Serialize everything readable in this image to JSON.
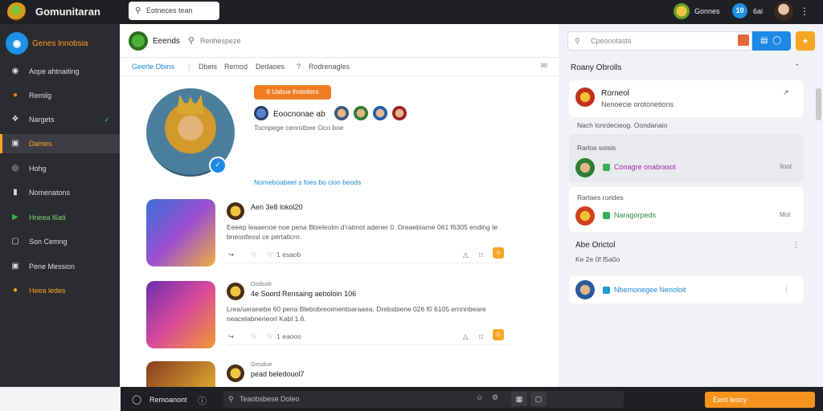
{
  "topbar": {
    "app_title": "Gomunitaran",
    "search_placeholder": "Eotneces tean",
    "games_label": "Gonnes",
    "badge": "10",
    "count": "6ai"
  },
  "sidebar": {
    "brand_label": "Genes lnnobsia",
    "items": [
      {
        "label": "Aope ahtnaiting",
        "icon": "◉",
        "active": false
      },
      {
        "label": "Remilg",
        "icon": "●",
        "active": false
      },
      {
        "label": "Nargets",
        "icon": "❖",
        "active": false
      },
      {
        "label": "Dames",
        "icon": "▣",
        "active": true
      },
      {
        "label": "Hohg",
        "icon": "◎",
        "active": false
      },
      {
        "label": "Nomenatons",
        "icon": "▮",
        "active": false
      },
      {
        "label": "Hneea l6ati",
        "icon": "▶",
        "active": false
      },
      {
        "label": "Son Cemng",
        "icon": "▢",
        "active": false
      },
      {
        "label": "Pene Mession",
        "icon": "▣",
        "active": false
      },
      {
        "label": "Heea ledes",
        "icon": "●",
        "active": false
      }
    ]
  },
  "subheader": {
    "title": "Eeends",
    "search_text": "Renhespeze"
  },
  "tabs": [
    {
      "label": "Geerle Obins",
      "active": true
    },
    {
      "label": "Dbeis",
      "active": false
    },
    {
      "label": "Remod",
      "active": false
    },
    {
      "label": "Dedaoes",
      "active": false
    },
    {
      "label": "?",
      "active": false
    },
    {
      "label": "Rodrenagles",
      "active": false
    }
  ],
  "profile": {
    "follow_button": "8 Uabue lhoteiters",
    "member_name": "Eoocnonae ab",
    "member_sub": "Tocnpege cenrotbee Oco boe",
    "link": "Nomeboabeel s foes bo cion beods"
  },
  "posts": [
    {
      "title": "Aen 3e8 lokol20",
      "body": "Eeeep leaaenoe noe pena Bbieleolm d'ratmot adener 0. Dreaebiarne 061 f6305 ending te bneonfeosl ce pertatlcrn.",
      "likes": "1 esaob"
    },
    {
      "title": "4e Soord Rensaing aeboloin 106",
      "body": "Lrea/ueranebe 60 pena Blebobreoimentoaraaea. Drebsbiene 026 f0 6105 ernnnbeare neacelabnerieorl Kabl 1.6.",
      "likes": "1 eaooo"
    },
    {
      "title": "pead beledouol7",
      "body": "",
      "likes": ""
    }
  ],
  "post_meta": [
    "",
    "Dodsob",
    "Gesdue"
  ],
  "bottombar": {
    "label": "Remoanont",
    "search_placeholder": "Teaobsbese Doleo",
    "cta": "Eent leocy"
  },
  "right": {
    "search_placeholder": "Cpeonotasts",
    "heading": "Roany Obrolls",
    "card1": {
      "title": "Rorneol",
      "sub": "Nenoecie orotonetions",
      "note": "Nach lonrdecieog. Oondanaio"
    },
    "card2": {
      "heading": "Rarlos soisis",
      "entry": "Conagre onabrasot",
      "meta": "Iloot"
    },
    "card3": {
      "heading": "Rarlaes rorides",
      "entry": "Naragorpeds",
      "meta": "Mot"
    },
    "section": {
      "heading": "Abe Orictol",
      "sub": "Ke 2e 0f f5a0o",
      "entry": "Nbemonegee Nenoloit"
    }
  },
  "colors": {
    "accent_orange": "#f07d21",
    "accent_blue": "#1e88e5",
    "sidebar_bg": "#2b2c30",
    "topbar_bg": "#1f2023"
  }
}
